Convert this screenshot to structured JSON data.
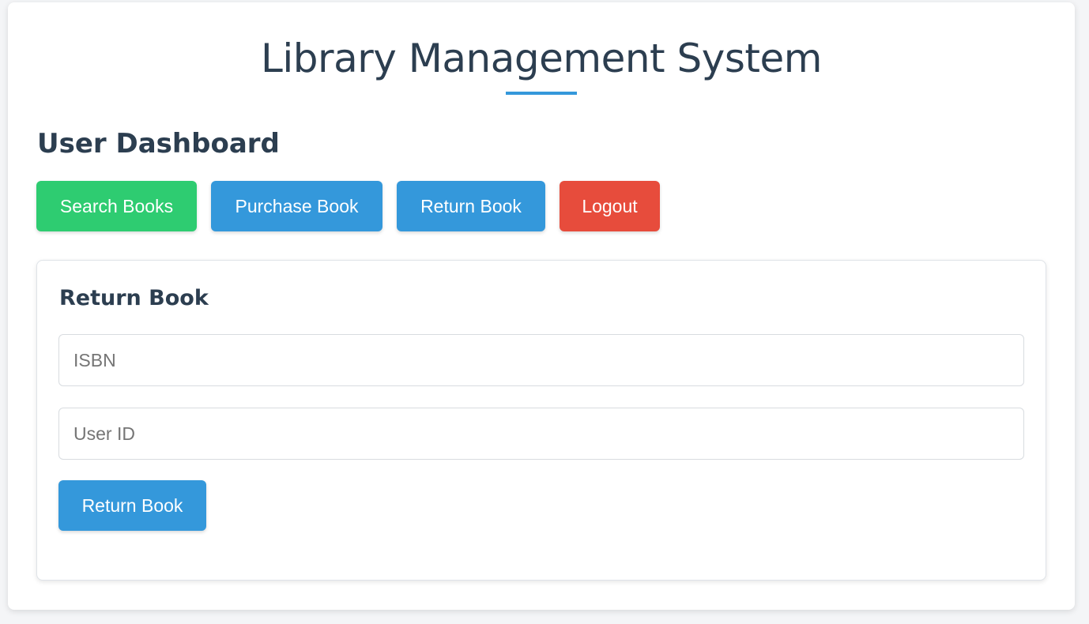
{
  "header": {
    "title": "Library Management System"
  },
  "dashboard": {
    "heading": "User Dashboard",
    "nav_buttons": [
      {
        "label": "Search Books",
        "color": "#2ecc71"
      },
      {
        "label": "Purchase Book",
        "color": "#3498db"
      },
      {
        "label": "Return Book",
        "color": "#3498db"
      },
      {
        "label": "Logout",
        "color": "#e74c3c"
      }
    ]
  },
  "return_form": {
    "heading": "Return Book",
    "isbn": {
      "value": "",
      "placeholder": "ISBN"
    },
    "user_id": {
      "value": "",
      "placeholder": "User ID"
    },
    "submit_label": "Return Book"
  },
  "colors": {
    "accent": "#3498db",
    "success": "#2ecc71",
    "danger": "#e74c3c",
    "heading_text": "#2c3e50"
  }
}
